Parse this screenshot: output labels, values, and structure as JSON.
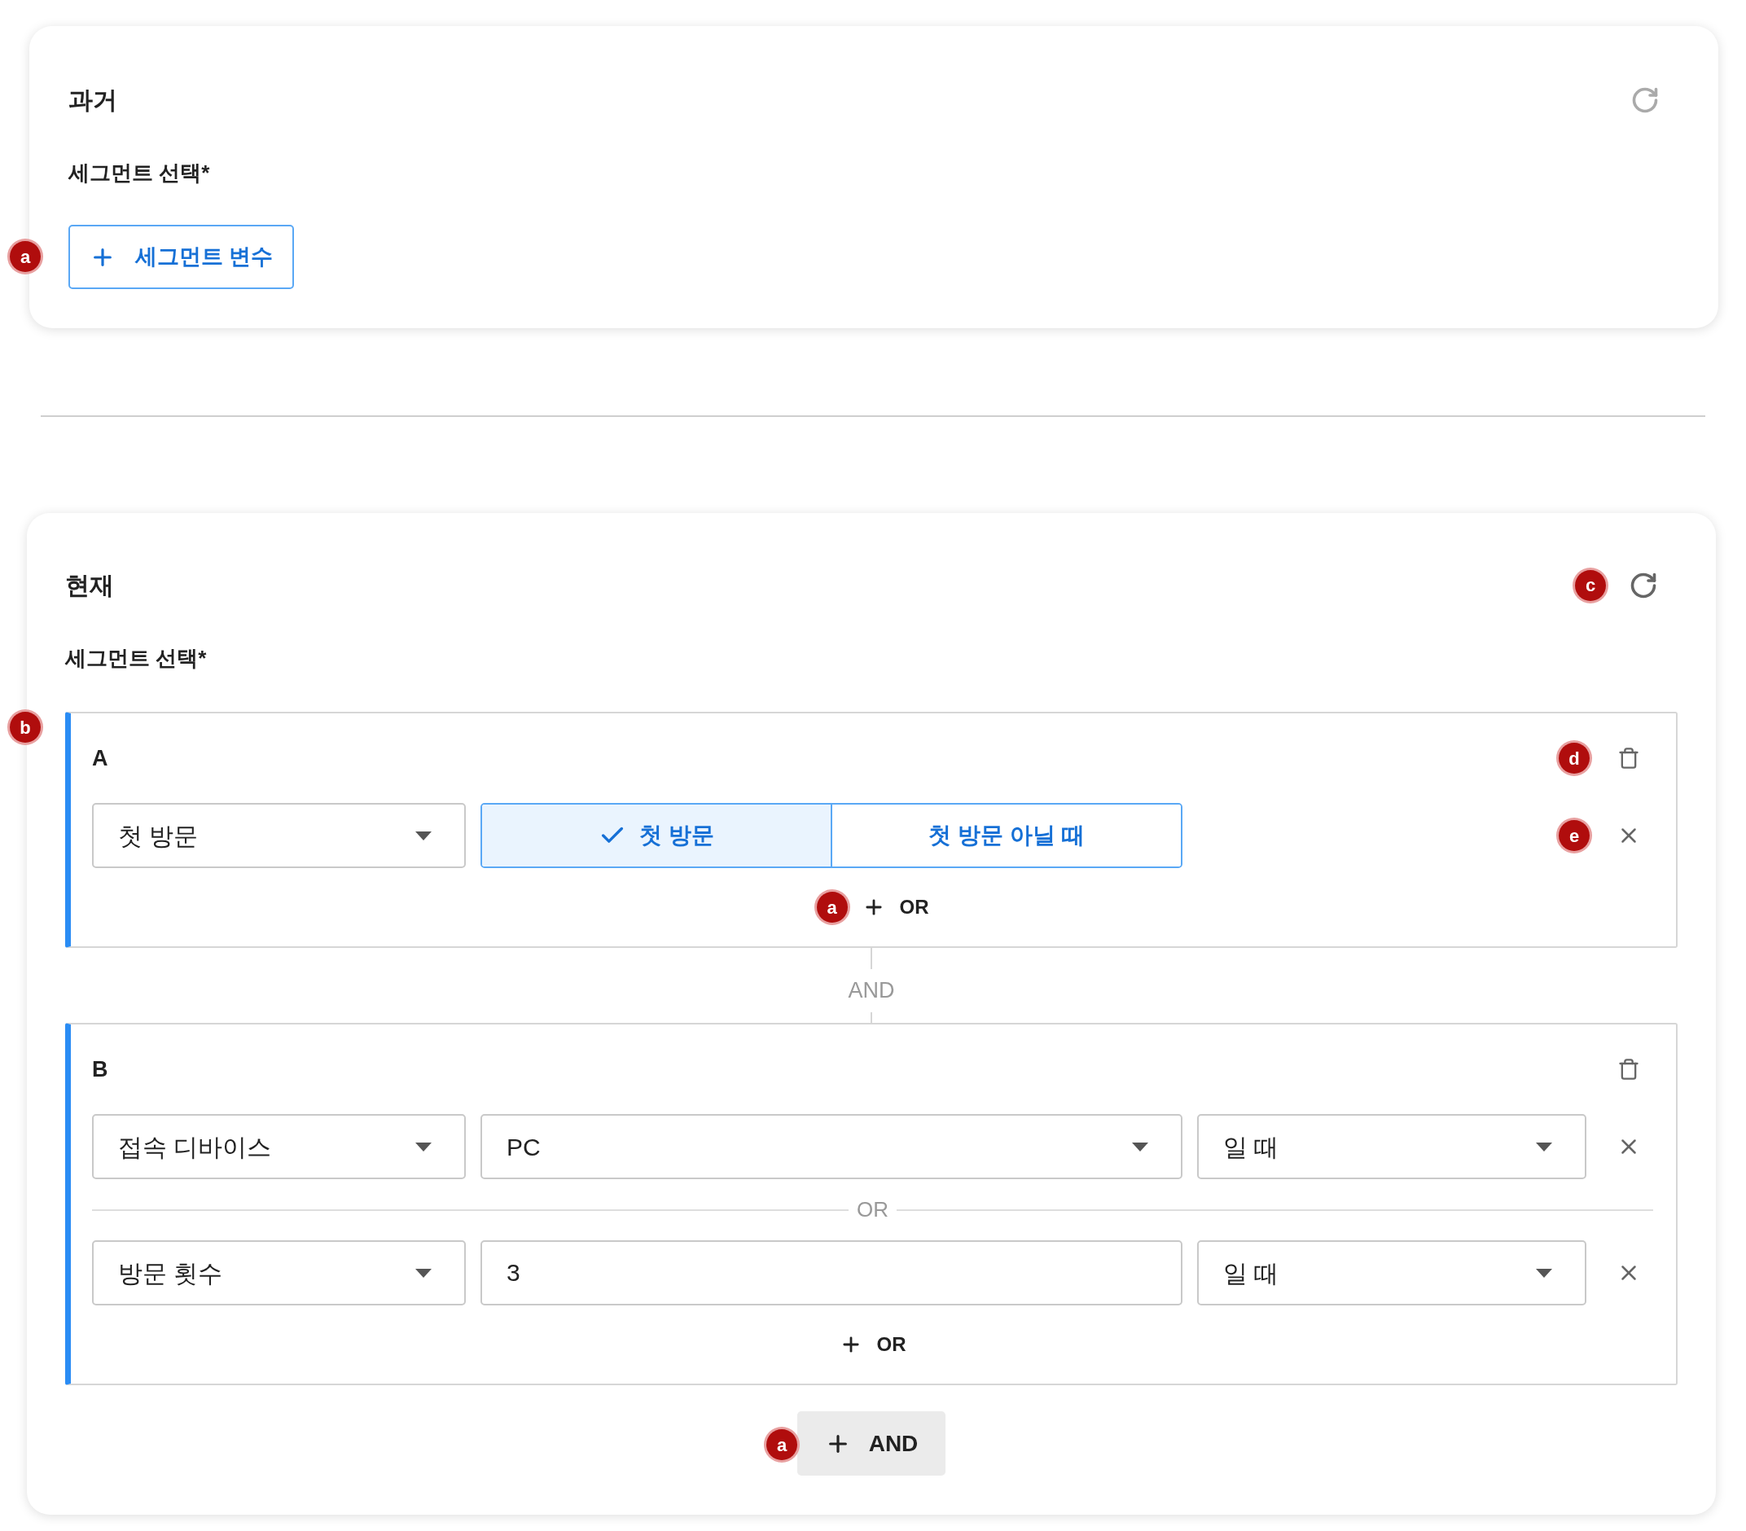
{
  "past": {
    "title": "과거",
    "label": "세그먼트 선택*",
    "add_button": "세그먼트 변수",
    "marker": "a"
  },
  "present": {
    "title": "현재",
    "refresh_marker": "c",
    "label": "세그먼트 선택*",
    "groups_marker": "b",
    "groups": [
      {
        "name": "A",
        "delete_marker": "d",
        "add_or": "OR",
        "add_or_marker": "a",
        "rows": [
          {
            "kind": "toggle",
            "field": "첫 방문",
            "remove_marker": "e",
            "options": [
              {
                "label": "첫 방문",
                "selected": true
              },
              {
                "label": "첫 방문 아닐 때",
                "selected": false
              }
            ]
          }
        ]
      },
      {
        "name": "B",
        "add_or": "OR",
        "row_separator": "OR",
        "rows": [
          {
            "kind": "select",
            "field": "접속 디바이스",
            "value": "PC",
            "condition": "일 때"
          },
          {
            "kind": "input",
            "field": "방문 횟수",
            "value": "3",
            "condition": "일 때"
          }
        ]
      }
    ],
    "and_connector": "AND",
    "add_and": "AND",
    "add_and_marker": "a"
  }
}
